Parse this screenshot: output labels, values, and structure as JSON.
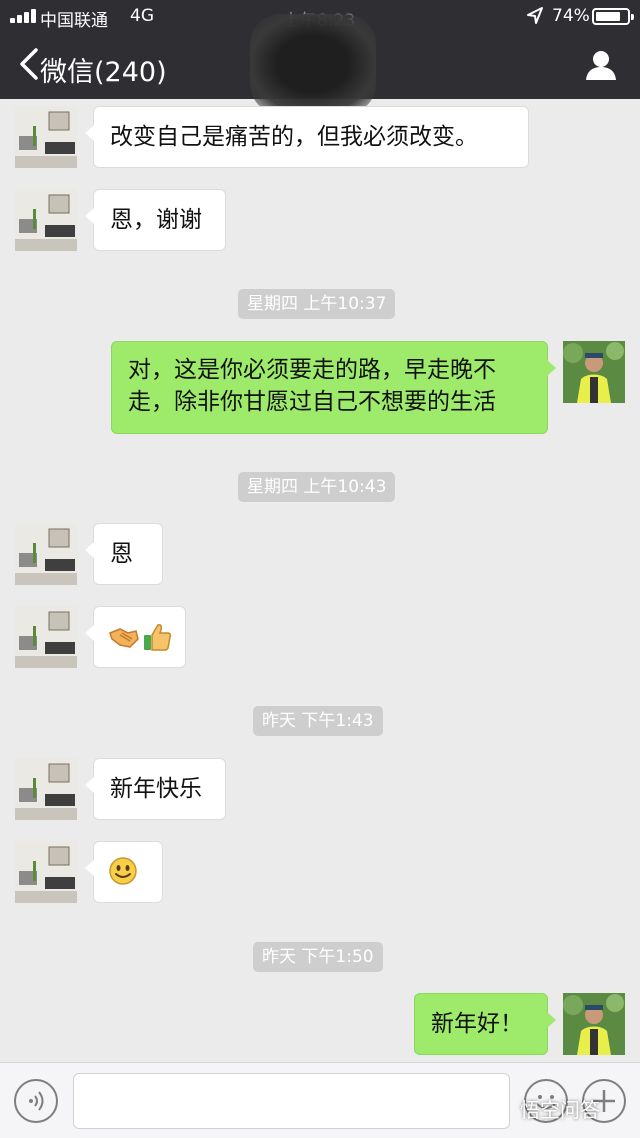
{
  "status_bar": {
    "carrier": "中国联通",
    "network": "4G",
    "time": "上午8:23",
    "battery": "74%"
  },
  "nav": {
    "back_label": "微信(240)"
  },
  "messages": [
    {
      "side": "in",
      "text": "改变自己是痛苦的，但我必须改变。"
    },
    {
      "side": "in",
      "text": "恩，谢谢"
    },
    {
      "timestamp": "星期四 上午10:37"
    },
    {
      "side": "out",
      "text": "对，这是你必须要走的路，早走晚不走，除非你甘愿过自己不想要的生活"
    },
    {
      "timestamp": "星期四 上午10:43"
    },
    {
      "side": "in",
      "text": "恩"
    },
    {
      "side": "in",
      "icons": [
        "handshake-emoji",
        "thumbs-up-emoji"
      ]
    },
    {
      "timestamp": "昨天 下午1:43"
    },
    {
      "side": "in",
      "text": "新年快乐"
    },
    {
      "side": "in",
      "icons": [
        "smile-emoji"
      ]
    },
    {
      "timestamp": "昨天 下午1:50"
    },
    {
      "side": "out",
      "text": "新年好！"
    }
  ],
  "watermark": "悟空问答",
  "colors": {
    "nav_bg": "#2e2e33",
    "chat_bg": "#ebebeb",
    "incoming_bubble": "#ffffff",
    "outgoing_bubble": "#9eea6a",
    "time_chip": "#cecece"
  }
}
